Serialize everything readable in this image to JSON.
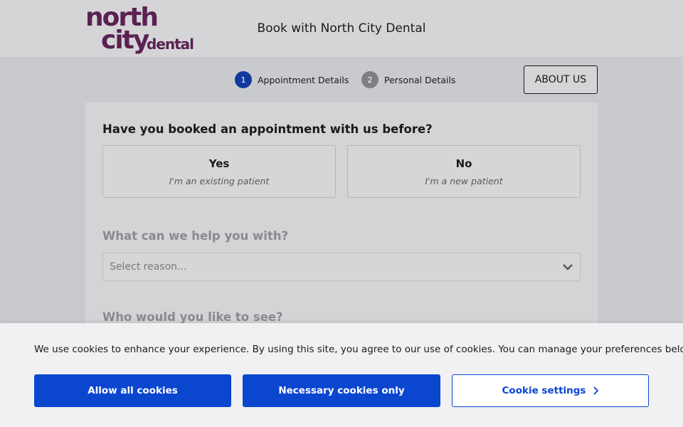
{
  "header": {
    "logo": {
      "line1": "north",
      "line2": "city",
      "line3": "dental"
    },
    "title": "Book with North City Dental"
  },
  "steps": [
    {
      "number": "1",
      "label": "Appointment Details"
    },
    {
      "number": "2",
      "label": "Personal Details"
    }
  ],
  "about_button": "ABOUT US",
  "form": {
    "q1": "Have you booked an appointment with us before?",
    "choices": [
      {
        "title": "Yes",
        "subtitle": "I'm an existing patient"
      },
      {
        "title": "No",
        "subtitle": "I'm a new patient"
      }
    ],
    "q2": "What can we help you with?",
    "reason_placeholder": "Select reason...",
    "q3": "Who would you like to see?"
  },
  "cookie": {
    "text": "We use cookies to enhance your experience. By using this site, you agree to our use of cookies. You can manage your preferences below.",
    "allow_all": "Allow all cookies",
    "necessary_only": "Necessary cookies only",
    "settings": "Cookie settings"
  },
  "colors": {
    "brand": "#5b2152",
    "accent": "#0b46cf",
    "step_active": "#123a9e",
    "step_inactive": "#7e7f82"
  },
  "icons": {
    "select": "chevron-down-icon",
    "settings": "chevron-right-icon"
  }
}
